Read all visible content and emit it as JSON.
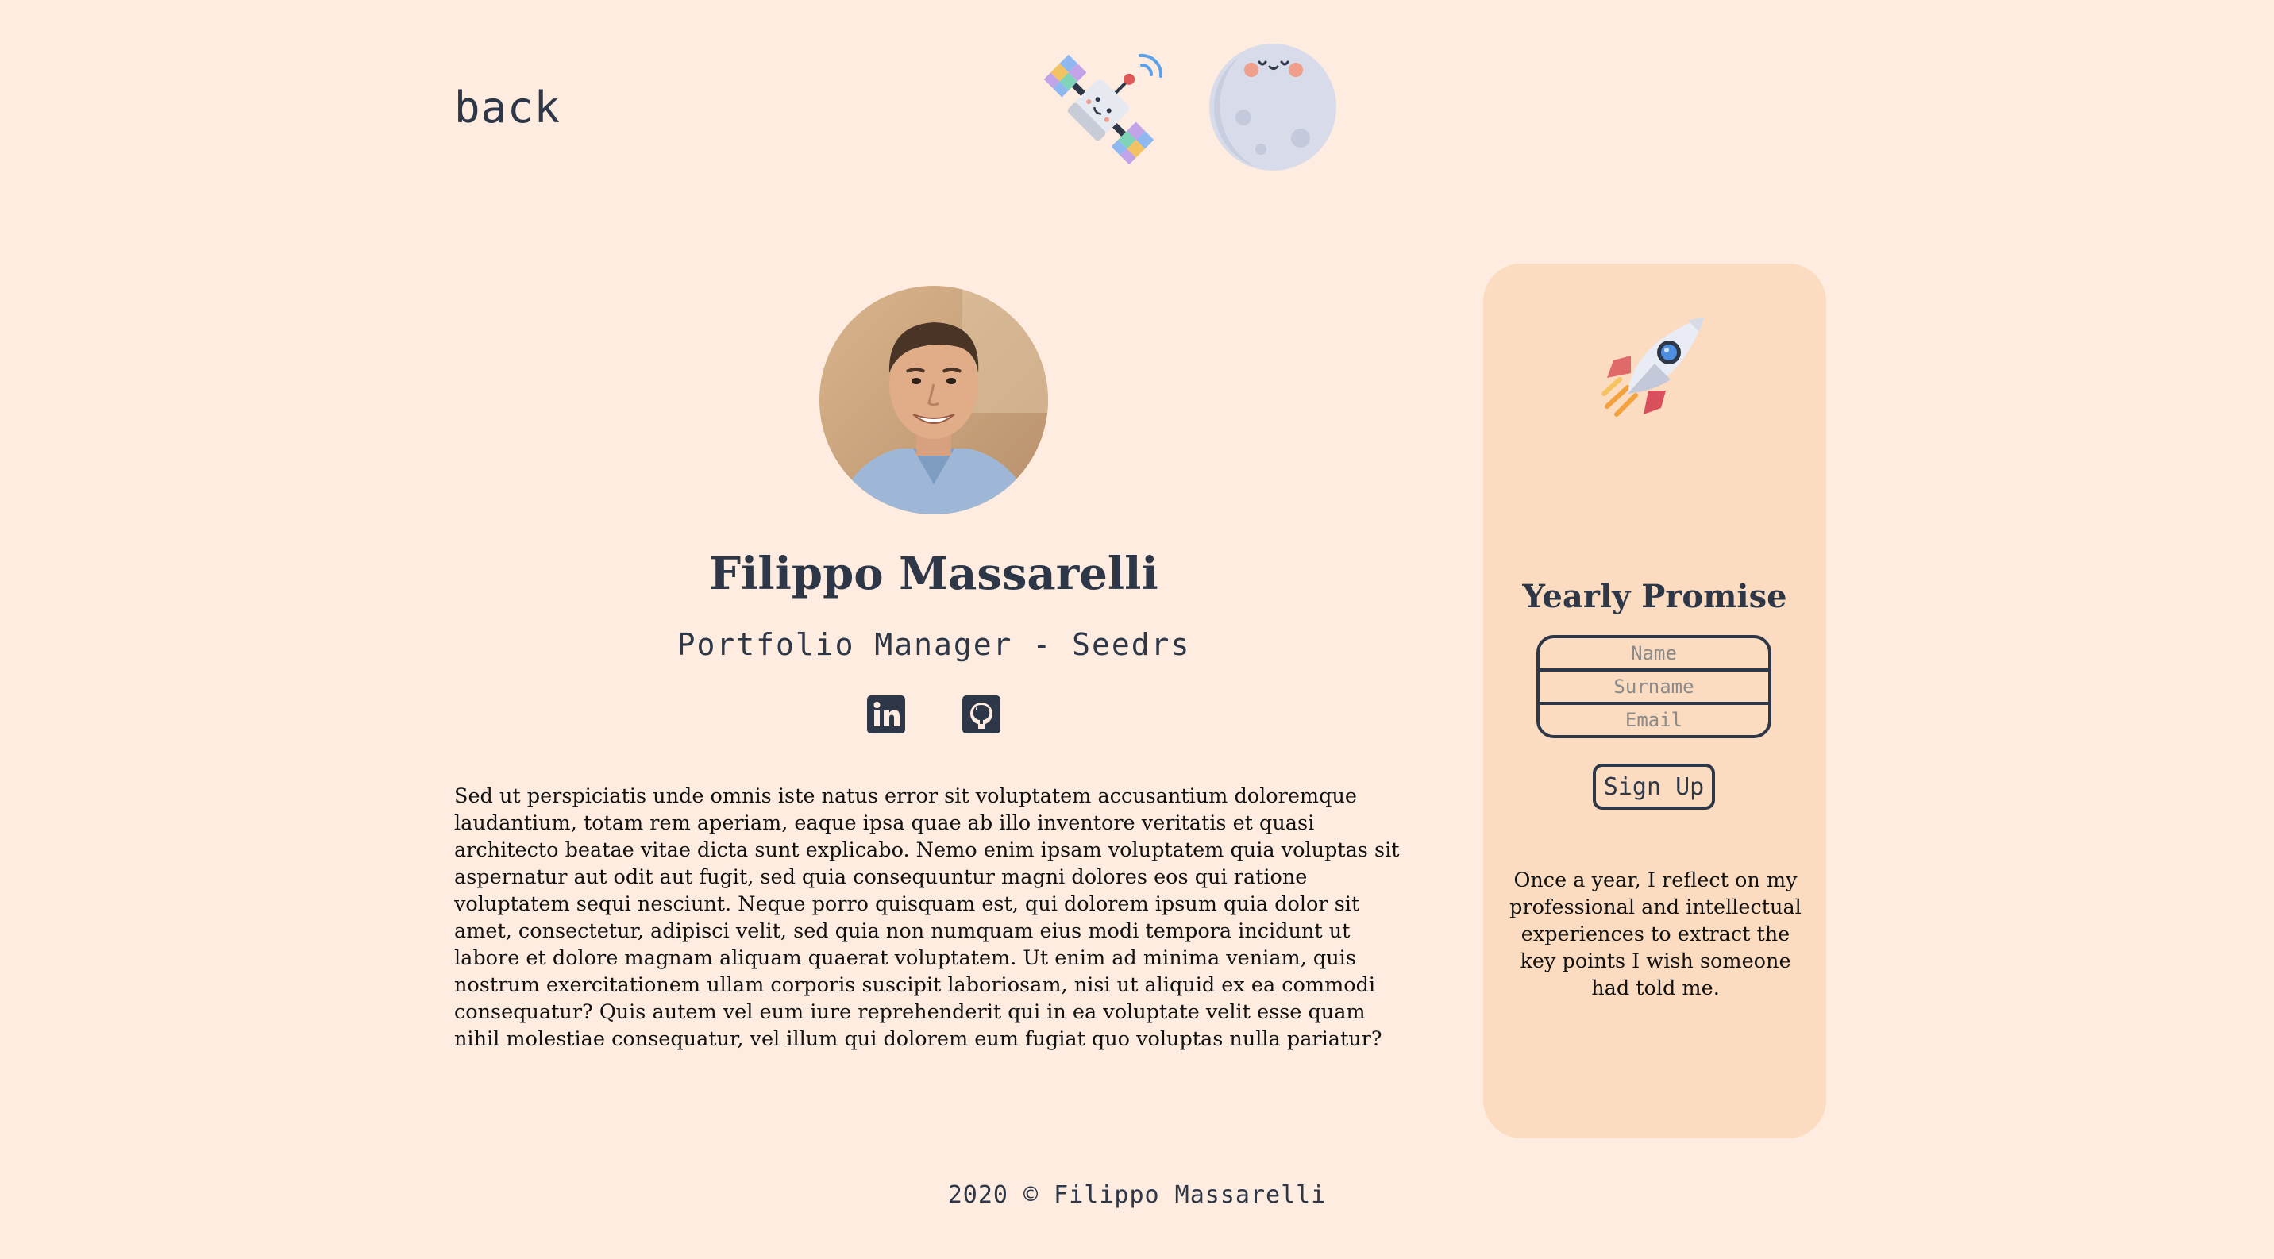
{
  "header": {
    "back_label": "back",
    "satellite_icon": "satellite-icon",
    "moon_icon": "moon-icon"
  },
  "profile": {
    "avatar": "profile-photo",
    "name": "Filippo Massarelli",
    "role": "Portfolio Manager - Seedrs",
    "social": [
      "linkedin-icon",
      "github-icon"
    ],
    "bio": "Sed ut perspiciatis unde omnis iste natus error sit voluptatem accusantium doloremque laudantium, totam rem aperiam, eaque ipsa quae ab illo inventore veritatis et quasi architecto beatae vitae dicta sunt explicabo. Nemo enim ipsam voluptatem quia voluptas sit aspernatur aut odit aut fugit, sed quia consequuntur magni dolores eos qui ratione voluptatem sequi nesciunt. Neque porro quisquam est, qui dolorem ipsum quia dolor sit amet, consectetur, adipisci velit, sed quia non numquam eius modi tempora incidunt ut labore et dolore magnam aliquam quaerat voluptatem. Ut enim ad minima veniam, quis nostrum exercitationem ullam corporis suscipit laboriosam, nisi ut aliquid ex ea commodi consequatur? Quis autem vel eum iure reprehenderit qui in ea voluptate velit esse quam nihil molestiae consequatur, vel illum qui dolorem eum fugiat quo voluptas nulla pariatur?"
  },
  "sidebar": {
    "icon": "rocket-icon",
    "title": "Yearly Promise",
    "fields": {
      "name_placeholder": "Name",
      "surname_placeholder": "Surname",
      "email_placeholder": "Email"
    },
    "signup_label": "Sign Up",
    "description": "Once a year, I reflect on my professional and intellectual experiences to extract the key points I wish someone had told me."
  },
  "footer": {
    "text": "2020 © Filippo Massarelli"
  },
  "colors": {
    "background": "#fdecdf",
    "card": "#fbdcc0",
    "text": "#2d3748"
  }
}
